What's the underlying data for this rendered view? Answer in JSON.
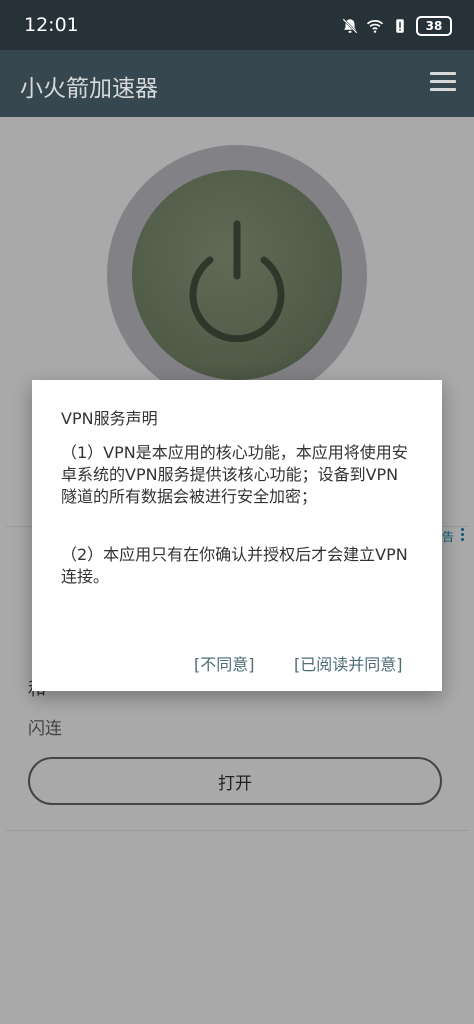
{
  "status_bar": {
    "time": "12:01",
    "battery": "38",
    "icons": [
      "mute-bell-icon",
      "wifi-icon",
      "battery-alert-icon",
      "battery-icon"
    ]
  },
  "app_bar": {
    "title": "小火箭加速器",
    "menu_icon": "hamburger-menu-icon"
  },
  "main": {
    "power_icon": "power-icon",
    "ad_label": "告",
    "hidden_label": "和",
    "flash_label": "闪连",
    "open_button": "打开"
  },
  "dialog": {
    "title": "VPN服务声明",
    "paragraph_1": "（1）VPN是本应用的核心功能，本应用将使用安卓系统的VPN服务提供该核心功能；设备到VPN隧道的所有数据会被进行安全加密；",
    "paragraph_2": "（2）本应用只有在你确认并授权后才会建立VPN连接。",
    "disagree_button": "[不同意]",
    "agree_button": "[已阅读并同意]"
  },
  "colors": {
    "status_bar": "#263238",
    "app_bar": "#37474f",
    "background_dimmed": "#a9a9a9",
    "dialog_button": "#4e6d76"
  }
}
